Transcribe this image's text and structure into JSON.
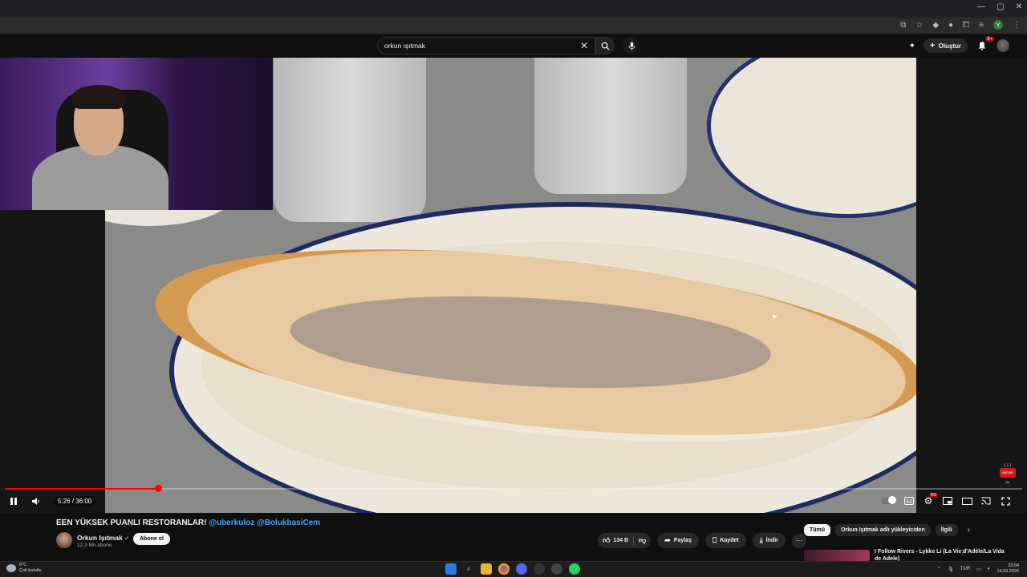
{
  "browser": {
    "window_controls": [
      "—",
      "▢",
      "✕"
    ]
  },
  "header": {
    "search_value": "orkun ışıtmak",
    "create_label": "Oluştur",
    "notification_badge": "9+"
  },
  "player": {
    "current_time": "5:26",
    "duration": "36:00",
    "time_display": "5:26 / 36:00",
    "progress_fraction": 0.151,
    "subscribe_overlay_text": "ABONE OL"
  },
  "video": {
    "title_main": "EEN YÜKSEK PUANLI RESTORANLAR!",
    "title_tags": "@uberkuloz @BolukbasiCem",
    "channel_name": "Orkun Işıtmak",
    "verified_mark": "✓",
    "subscribers": "12,3 Mn abone",
    "subscribe_label": "Abone ol",
    "like_count": "134 B",
    "share_label": "Paylaş",
    "save_label": "Kaydet",
    "download_label": "İndir",
    "more_label": "⋯"
  },
  "sidebar": {
    "chips": [
      "Tümü",
      "Orkun Işıtmak adlı yükleyiciden",
      "İlgili"
    ],
    "rec_title": "I Follow Rivers - Lykke Li (La Vie d'Adèle/La Vida de Adele)"
  },
  "taskbar": {
    "temperature": "6°C",
    "weather_desc": "Çok bulutlu",
    "language": "TUR",
    "time": "23:04",
    "date": "14.03.2026"
  },
  "colors": {
    "accent_red": "#ff0000",
    "link_blue": "#3ea6ff",
    "background": "#0f0f0f"
  }
}
